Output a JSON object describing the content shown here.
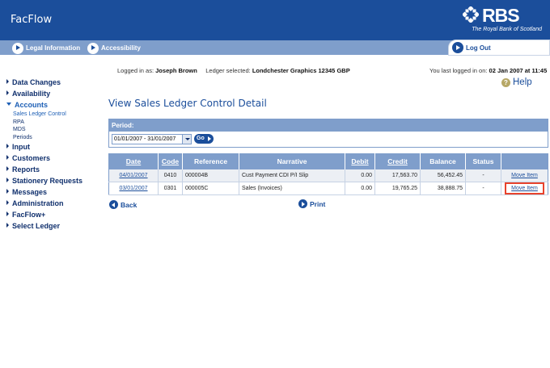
{
  "header": {
    "app_title": "FacFlow",
    "brand_name": "RBS",
    "brand_tagline": "The Royal Bank of Scotland"
  },
  "navbar": {
    "legal": "Legal Information",
    "accessibility": "Accessibility",
    "logout": "Log Out"
  },
  "session": {
    "logged_in_label": "Logged in as:",
    "user": "Joseph Brown",
    "ledger_label": "Ledger selected:",
    "ledger": "Londchester Graphics  12345  GBP",
    "last_login_label": "You last logged in on:",
    "last_login": "02 Jan 2007 at 11:45"
  },
  "help": {
    "label": "Help",
    "icon_glyph": "?"
  },
  "sidebar": {
    "items": [
      {
        "label": "Data Changes"
      },
      {
        "label": "Availability"
      },
      {
        "label": "Accounts"
      },
      {
        "label": "Input"
      },
      {
        "label": "Customers"
      },
      {
        "label": "Reports"
      },
      {
        "label": "Stationery Requests"
      },
      {
        "label": "Messages"
      },
      {
        "label": "Administration"
      },
      {
        "label": "FacFlow+"
      },
      {
        "label": "Select Ledger"
      }
    ],
    "accounts_sub": [
      {
        "label": "Sales Ledger Control"
      },
      {
        "label": "RPA"
      },
      {
        "label": "MDS"
      },
      {
        "label": "Periods"
      }
    ]
  },
  "page": {
    "title": "View Sales Ledger Control Detail"
  },
  "period": {
    "label": "Period:",
    "selected": "01/01/2007 - 31/01/2007",
    "go_label": "Go"
  },
  "table": {
    "headers": {
      "date": "Date",
      "code": "Code",
      "reference": "Reference",
      "narrative": "Narrative",
      "debit": "Debit",
      "credit": "Credit",
      "balance": "Balance",
      "status": "Status"
    },
    "rows": [
      {
        "date": "04/01/2007",
        "code": "0410",
        "reference": "000004B",
        "narrative": "Cust Payment CDI P/I Slip",
        "debit": "0.00",
        "credit": "17,563.70",
        "balance": "56,452.45",
        "status": "-",
        "action": "Move Item"
      },
      {
        "date": "03/01/2007",
        "code": "0301",
        "reference": "000005C",
        "narrative": "Sales (Invoices)",
        "debit": "0.00",
        "credit": "19,765.25",
        "balance": "38,888.75",
        "status": "-",
        "action": "Move Item"
      }
    ]
  },
  "footer_links": {
    "back": "Back",
    "print": "Print"
  },
  "colors": {
    "header_blue": "#1b4e9b",
    "nav_light_blue": "#7f9ecb",
    "highlight_red": "#e8432d"
  }
}
